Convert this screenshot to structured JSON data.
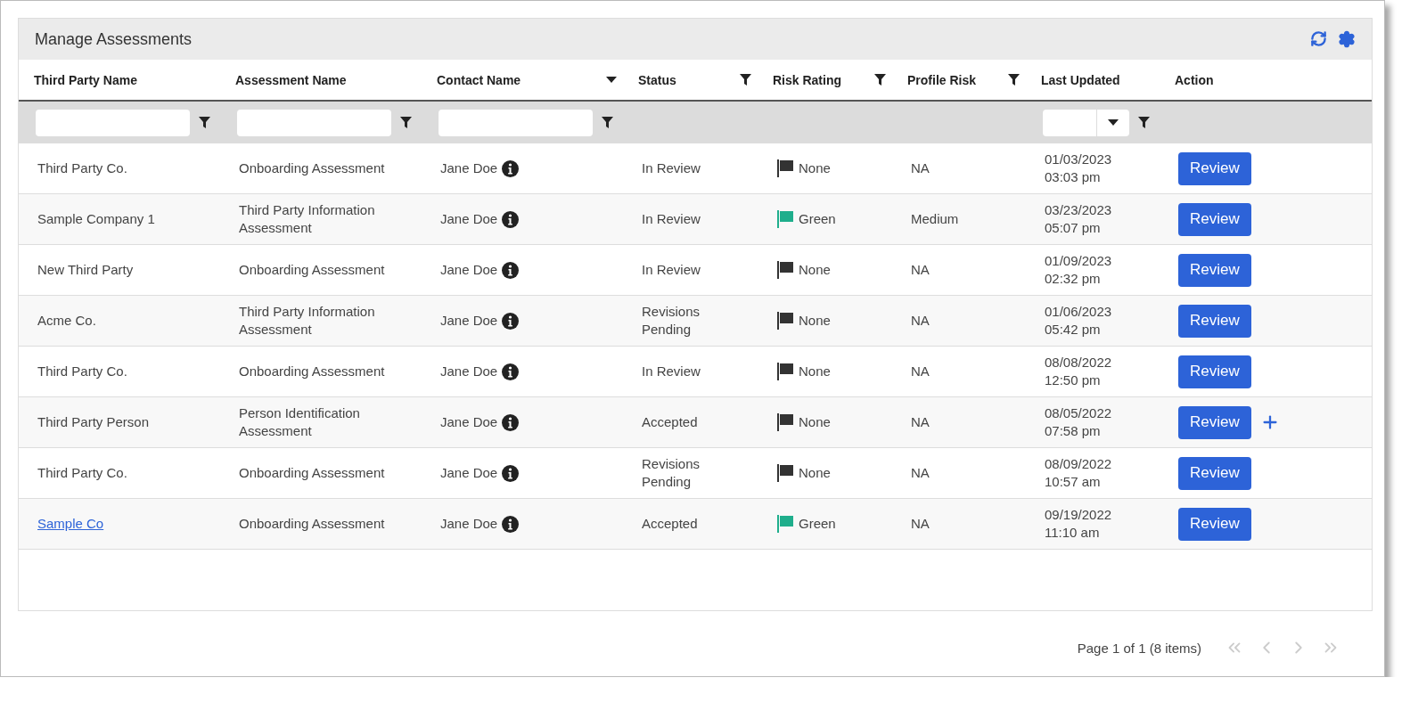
{
  "panel": {
    "title": "Manage Assessments"
  },
  "table": {
    "columns": [
      {
        "label": "Third Party Name",
        "kind": "plain"
      },
      {
        "label": "Assessment Name",
        "kind": "plain"
      },
      {
        "label": "Contact Name",
        "kind": "caret"
      },
      {
        "label": "Status",
        "kind": "filter"
      },
      {
        "label": "Risk Rating",
        "kind": "filter"
      },
      {
        "label": "Profile Risk",
        "kind": "filter"
      },
      {
        "label": "Last Updated",
        "kind": "plain"
      },
      {
        "label": "Action",
        "kind": "plain"
      }
    ],
    "filters": [
      {
        "kind": "text"
      },
      {
        "kind": "text"
      },
      {
        "kind": "text"
      },
      {
        "kind": "empty"
      },
      {
        "kind": "empty"
      },
      {
        "kind": "empty"
      },
      {
        "kind": "date"
      },
      {
        "kind": "empty"
      }
    ],
    "rows": [
      {
        "third_party": "Third Party Co.",
        "link": false,
        "assessment": "Onboarding Assessment",
        "contact": "Jane Doe",
        "status": "In Review",
        "risk": "None",
        "color": "#333333",
        "profile_risk": "NA",
        "date": "01/03/2023",
        "time": "03:03 pm",
        "action": "Review",
        "add": false
      },
      {
        "third_party": "Sample Company 1",
        "link": false,
        "assessment": "Third Party Information Assessment",
        "contact": "Jane Doe",
        "status": "In Review",
        "risk": "Green",
        "color": "#1fae8c",
        "profile_risk": "Medium",
        "date": "03/23/2023",
        "time": "05:07 pm",
        "action": "Review",
        "add": false
      },
      {
        "third_party": "New Third Party",
        "link": false,
        "assessment": "Onboarding Assessment",
        "contact": "Jane Doe",
        "status": "In Review",
        "risk": "None",
        "color": "#333333",
        "profile_risk": "NA",
        "date": "01/09/2023",
        "time": "02:32 pm",
        "action": "Review",
        "add": false
      },
      {
        "third_party": "Acme Co.",
        "link": false,
        "assessment": "Third Party Information Assessment",
        "contact": "Jane Doe",
        "status": "Revisions Pending",
        "risk": "None",
        "color": "#333333",
        "profile_risk": "NA",
        "date": "01/06/2023",
        "time": "05:42 pm",
        "action": "Review",
        "add": false
      },
      {
        "third_party": "Third Party Co.",
        "link": false,
        "assessment": "Onboarding Assessment",
        "contact": "Jane Doe",
        "status": "In Review",
        "risk": "None",
        "color": "#333333",
        "profile_risk": "NA",
        "date": "08/08/2022",
        "time": "12:50 pm",
        "action": "Review",
        "add": false
      },
      {
        "third_party": "Third Party Person",
        "link": false,
        "assessment": "Person Identification Assessment",
        "contact": "Jane Doe",
        "status": "Accepted",
        "risk": "None",
        "color": "#333333",
        "profile_risk": "NA",
        "date": "08/05/2022",
        "time": "07:58 pm",
        "action": "Review",
        "add": true
      },
      {
        "third_party": "Third Party Co.",
        "link": false,
        "assessment": "Onboarding Assessment",
        "contact": "Jane Doe",
        "status": "Revisions Pending",
        "risk": "None",
        "color": "#333333",
        "profile_risk": "NA",
        "date": "08/09/2022",
        "time": "10:57 am",
        "action": "Review",
        "add": false
      },
      {
        "third_party": "Sample Co",
        "link": true,
        "assessment": "Onboarding Assessment",
        "contact": "Jane Doe",
        "status": "Accepted",
        "risk": "Green",
        "color": "#1fae8c",
        "profile_risk": "NA",
        "date": "09/19/2022",
        "time": "11:10 am",
        "action": "Review",
        "add": false
      }
    ]
  },
  "pagination": {
    "summary": "Page 1 of 1 (8 items)",
    "disabled": true
  }
}
